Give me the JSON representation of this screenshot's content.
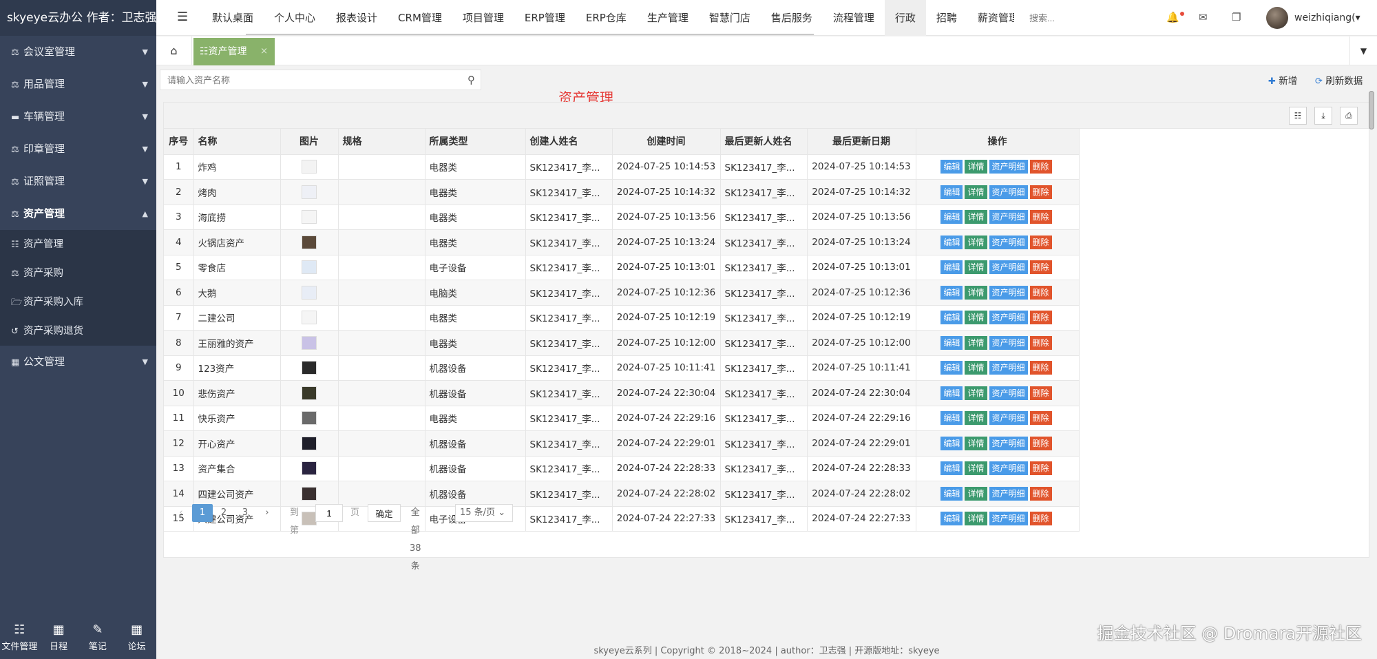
{
  "brand": "skyeye云办公 作者：卫志强",
  "sidebar": {
    "menus": [
      {
        "icon": "⚖",
        "label": "会议室管理"
      },
      {
        "icon": "⚖",
        "label": "用品管理"
      },
      {
        "icon": "▬",
        "label": "车辆管理"
      },
      {
        "icon": "⚖",
        "label": "印章管理"
      },
      {
        "icon": "⚖",
        "label": "证照管理"
      },
      {
        "icon": "⚖",
        "label": "资产管理"
      },
      {
        "icon": "▦",
        "label": "公文管理"
      }
    ],
    "submenu": [
      {
        "icon": "☷",
        "label": "资产管理"
      },
      {
        "icon": "⚖",
        "label": "资产采购"
      },
      {
        "icon": "🗁",
        "label": "资产采购入库"
      },
      {
        "icon": "↺",
        "label": "资产采购退货"
      }
    ],
    "bottom_tools": [
      {
        "icon": "☷",
        "label": "文件管理"
      },
      {
        "icon": "▦",
        "label": "日程"
      },
      {
        "icon": "✎",
        "label": "笔记"
      },
      {
        "icon": "▦",
        "label": "论坛"
      }
    ]
  },
  "topnav": {
    "items": [
      "默认桌面",
      "个人中心",
      "报表设计",
      "CRM管理",
      "项目管理",
      "ERP管理",
      "ERP仓库",
      "生产管理",
      "智慧门店",
      "售后服务",
      "流程管理",
      "行政",
      "招聘",
      "薪资管理"
    ],
    "active_index": 11,
    "search_placeholder": "搜索...",
    "user_name": "weizhiqiang(▾"
  },
  "tabs": {
    "home_icon": "⌂",
    "current": "☷资产管理",
    "close": "×",
    "more": "▼"
  },
  "content": {
    "search_placeholder": "请输入资产名称",
    "heading": "资产管理",
    "add_label": "新增",
    "refresh_label": "刷新数据"
  },
  "table": {
    "columns": [
      "序号",
      "名称",
      "图片",
      "规格",
      "所属类型",
      "创建人姓名",
      "创建时间",
      "最后更新人姓名",
      "最后更新日期",
      "操作"
    ],
    "op_labels": {
      "edit": "编辑",
      "detail": "详情",
      "asset": "资产明细",
      "delete": "删除"
    },
    "rows": [
      {
        "no": "1",
        "name": "炸鸡",
        "thumb": "#f3f3f3",
        "spec": "",
        "type": "电器类",
        "creator": "SK123417_李...",
        "created": "2024-07-25 10:14:53",
        "updater": "SK123417_李...",
        "updated": "2024-07-25 10:14:53"
      },
      {
        "no": "2",
        "name": "烤肉",
        "thumb": "#eef0f6",
        "spec": "",
        "type": "电器类",
        "creator": "SK123417_李...",
        "created": "2024-07-25 10:14:32",
        "updater": "SK123417_李...",
        "updated": "2024-07-25 10:14:32"
      },
      {
        "no": "3",
        "name": "海底捞",
        "thumb": "#f5f5f5",
        "spec": "",
        "type": "电器类",
        "creator": "SK123417_李...",
        "created": "2024-07-25 10:13:56",
        "updater": "SK123417_李...",
        "updated": "2024-07-25 10:13:56"
      },
      {
        "no": "4",
        "name": "火锅店资产",
        "thumb": "#5b4a3a",
        "spec": "",
        "type": "电器类",
        "creator": "SK123417_李...",
        "created": "2024-07-25 10:13:24",
        "updater": "SK123417_李...",
        "updated": "2024-07-25 10:13:24"
      },
      {
        "no": "5",
        "name": "零食店",
        "thumb": "#dfe9f5",
        "spec": "",
        "type": "电子设备",
        "creator": "SK123417_李...",
        "created": "2024-07-25 10:13:01",
        "updater": "SK123417_李...",
        "updated": "2024-07-25 10:13:01"
      },
      {
        "no": "6",
        "name": "大鹅",
        "thumb": "#e8edf6",
        "spec": "",
        "type": "电脑类",
        "creator": "SK123417_李...",
        "created": "2024-07-25 10:12:36",
        "updater": "SK123417_李...",
        "updated": "2024-07-25 10:12:36"
      },
      {
        "no": "7",
        "name": "二建公司",
        "thumb": "#f5f5f5",
        "spec": "",
        "type": "电器类",
        "creator": "SK123417_李...",
        "created": "2024-07-25 10:12:19",
        "updater": "SK123417_李...",
        "updated": "2024-07-25 10:12:19"
      },
      {
        "no": "8",
        "name": "王丽雅的资产",
        "thumb": "#c9c2e6",
        "spec": "",
        "type": "电器类",
        "creator": "SK123417_李...",
        "created": "2024-07-25 10:12:00",
        "updater": "SK123417_李...",
        "updated": "2024-07-25 10:12:00"
      },
      {
        "no": "9",
        "name": "123资产",
        "thumb": "#2a2a2a",
        "spec": "",
        "type": "机器设备",
        "creator": "SK123417_李...",
        "created": "2024-07-25 10:11:41",
        "updater": "SK123417_李...",
        "updated": "2024-07-25 10:11:41"
      },
      {
        "no": "10",
        "name": "悲伤资产",
        "thumb": "#3a3a2a",
        "spec": "",
        "type": "机器设备",
        "creator": "SK123417_李...",
        "created": "2024-07-24 22:30:04",
        "updater": "SK123417_李...",
        "updated": "2024-07-24 22:30:04"
      },
      {
        "no": "11",
        "name": "快乐资产",
        "thumb": "#6a6a6a",
        "spec": "",
        "type": "电器类",
        "creator": "SK123417_李...",
        "created": "2024-07-24 22:29:16",
        "updater": "SK123417_李...",
        "updated": "2024-07-24 22:29:16"
      },
      {
        "no": "12",
        "name": "开心资产",
        "thumb": "#1f1f2a",
        "spec": "",
        "type": "机器设备",
        "creator": "SK123417_李...",
        "created": "2024-07-24 22:29:01",
        "updater": "SK123417_李...",
        "updated": "2024-07-24 22:29:01"
      },
      {
        "no": "13",
        "name": "资产集合",
        "thumb": "#2a2440",
        "spec": "",
        "type": "机器设备",
        "creator": "SK123417_李...",
        "created": "2024-07-24 22:28:33",
        "updater": "SK123417_李...",
        "updated": "2024-07-24 22:28:33"
      },
      {
        "no": "14",
        "name": "四建公司资产",
        "thumb": "#3a3030",
        "spec": "",
        "type": "机器设备",
        "creator": "SK123417_李...",
        "created": "2024-07-24 22:28:02",
        "updater": "SK123417_李...",
        "updated": "2024-07-24 22:28:02"
      },
      {
        "no": "15",
        "name": "八建公司资产",
        "thumb": "#c8c0b8",
        "spec": "",
        "type": "电子设备",
        "creator": "SK123417_李...",
        "created": "2024-07-24 22:27:33",
        "updater": "SK123417_李...",
        "updated": "2024-07-24 22:27:33"
      }
    ]
  },
  "pagination": {
    "prev": "‹",
    "pages": [
      "1",
      "2",
      "3"
    ],
    "current": "1",
    "next": "›",
    "goto_label": "到第",
    "goto_value": "1",
    "page_unit": "页",
    "confirm": "确定",
    "total": "全部 38 条",
    "page_size": "15 条/页"
  },
  "footer": "skyeye云系列 | Copyright © 2018~2024 | author：卫志强 | 开源版地址：skyeye",
  "watermark": "掘金技术社区 @ Dromara开源社区"
}
